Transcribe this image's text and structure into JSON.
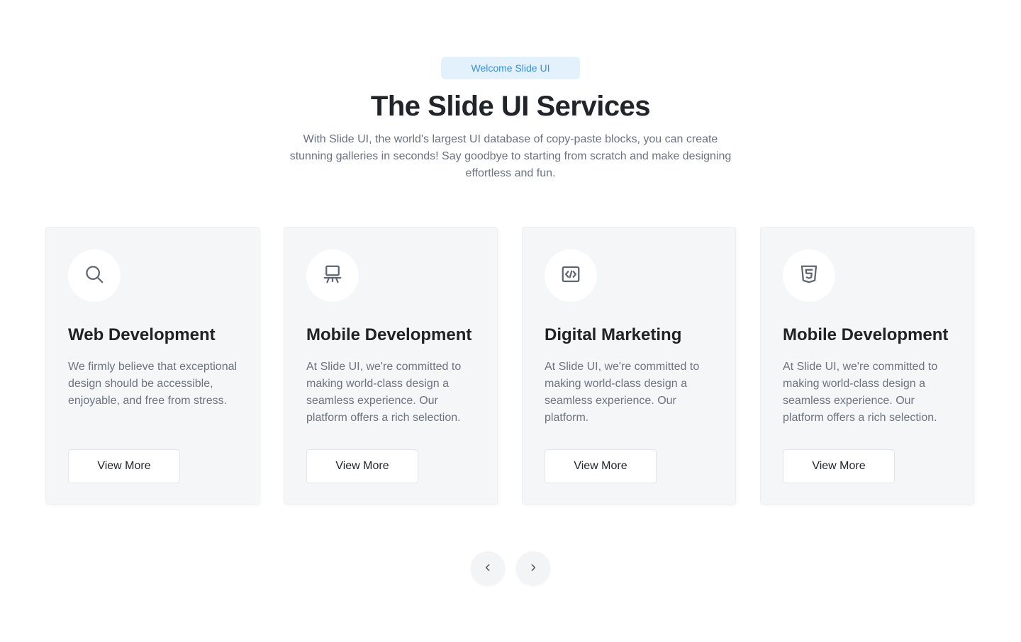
{
  "header": {
    "badge": "Welcome Slide UI",
    "title": "The Slide UI Services",
    "subtitle": "With Slide UI, the world's largest UI database of copy-paste blocks, you can create stunning galleries in seconds! Say goodbye to starting from scratch and make designing effortless and fun."
  },
  "cards": [
    {
      "icon": "search-icon",
      "title": "Web Development",
      "text": "We firmly believe that exceptional design should be accessible, enjoyable, and free from stress.",
      "button": "View More"
    },
    {
      "icon": "presentation-icon",
      "title": "Mobile Development",
      "text": "At Slide UI, we're committed to making world-class design a seamless experience. Our platform offers a rich selection.",
      "button": "View More"
    },
    {
      "icon": "code-icon",
      "title": "Digital Marketing",
      "text": "At Slide UI, we're committed to making world-class design a seamless experience. Our platform.",
      "button": "View More"
    },
    {
      "icon": "html5-icon",
      "title": "Mobile Development",
      "text": "At Slide UI, we're committed to making world-class design a seamless experience. Our platform offers a rich selection.",
      "button": "View More"
    }
  ],
  "pagination": {
    "prev_icon": "chevron-left-icon",
    "next_icon": "chevron-right-icon"
  },
  "colors": {
    "badge_bg": "#e3f1fc",
    "badge_text": "#3a8fd8",
    "card_bg": "#f5f6f8",
    "icon": "#5f6670"
  }
}
